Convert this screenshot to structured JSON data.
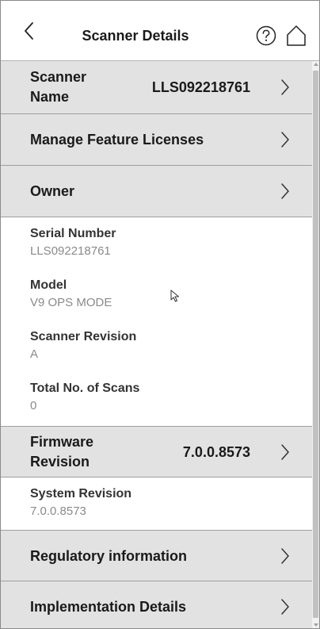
{
  "header": {
    "title": "Scanner Details",
    "back_icon": "chevron-left-icon",
    "help_icon": "question-circle-icon",
    "home_icon": "home-icon"
  },
  "rows": {
    "scanner_name": {
      "label_line1": "Scanner",
      "label_line2": "Name",
      "value": "LLS092218761"
    },
    "manage_licenses": {
      "label": "Manage Feature Licenses"
    },
    "owner": {
      "label": "Owner"
    },
    "firmware": {
      "label_line1": "Firmware",
      "label_line2": "Revision",
      "value": "7.0.0.8573"
    },
    "regulatory": {
      "label": "Regulatory information"
    },
    "implementation": {
      "label": "Implementation Details"
    }
  },
  "info": {
    "serial_number": {
      "label": "Serial Number",
      "value": "LLS092218761"
    },
    "model": {
      "label": "Model",
      "value": "V9 OPS MODE"
    },
    "scanner_revision": {
      "label": "Scanner Revision",
      "value": "A"
    },
    "total_scans": {
      "label": "Total No. of Scans",
      "value": "0"
    },
    "system_revision": {
      "label": "System Revision",
      "value": "7.0.0.8573"
    }
  },
  "colors": {
    "row_background": "#e2e2e2",
    "info_background": "#ffffff",
    "label_text": "#1a1a1a",
    "value_text": "#8a8a8a"
  }
}
